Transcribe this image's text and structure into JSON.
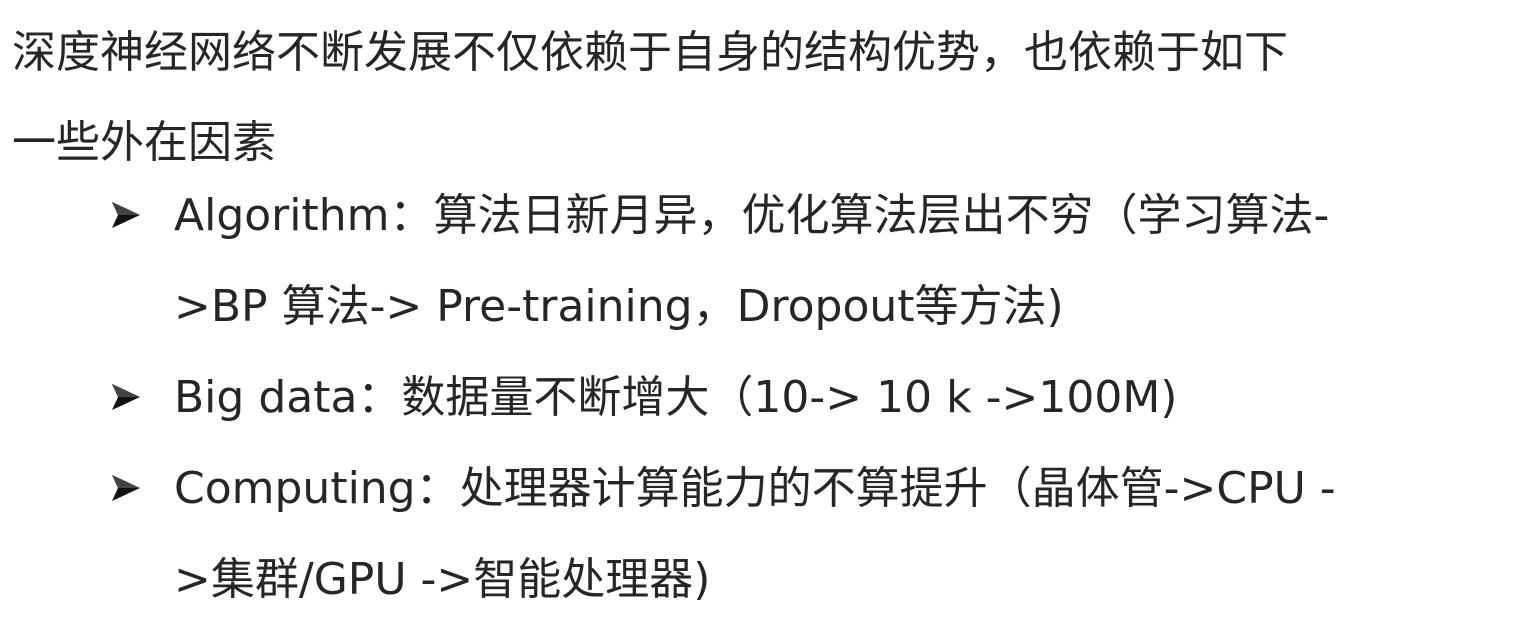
{
  "intro": {
    "line1": "深度神经网络不断发展不仅依赖于自身的结构优势，也依赖于如下",
    "line2": "一些外在因素"
  },
  "bullets": [
    {
      "icon": "arrow-bullet-icon",
      "line1": "Algorithm：算法日新月异，优化算法层出不穷（学习算法-",
      "line2": ">BP 算法-> Pre-training，Dropout等方法)"
    },
    {
      "icon": "arrow-bullet-icon",
      "line1": "Big data：数据量不断增大（10-> 10 k ->100M)"
    },
    {
      "icon": "arrow-bullet-icon",
      "line1": "Computing：处理器计算能力的不算提升（晶体管->CPU -",
      "line2": ">集群/GPU ->智能处理器)"
    }
  ],
  "colors": {
    "text": "#262626",
    "background": "#ffffff"
  }
}
